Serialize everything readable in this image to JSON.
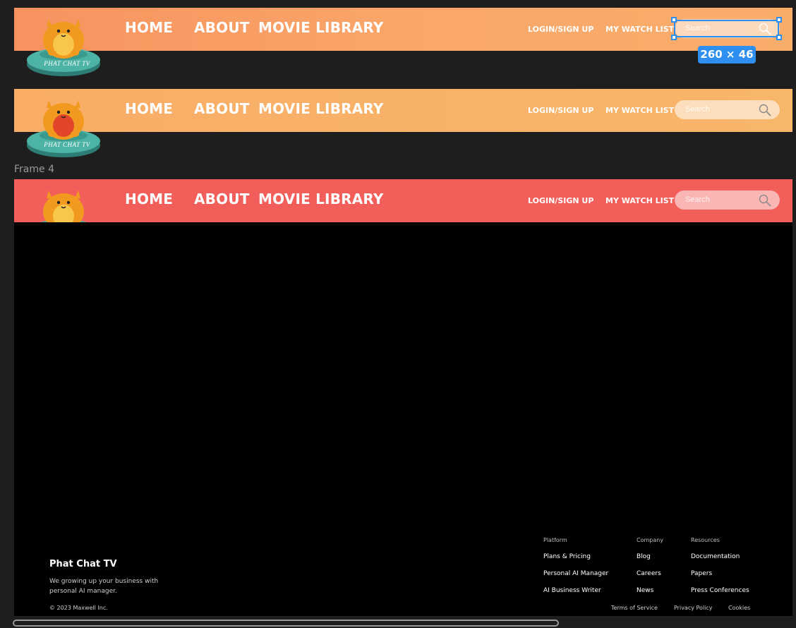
{
  "colors": {
    "canvas_bg": "#1e1e1e",
    "header_1_gradient": [
      "#f8925f",
      "#f9a86a",
      "#f9ad6b"
    ],
    "header_2_gradient": [
      "#f9ad66",
      "#f8b66b"
    ],
    "header_3_bg": "#f25e59",
    "selection_accent": "#2f8ff0",
    "frame_body_bg": "#000000"
  },
  "logo": {
    "text": "PHAT CHAT TV",
    "icon": "orange-cat-on-teal-cushion"
  },
  "nav": {
    "home": "HOME",
    "about": "ABOUT",
    "movie_library": "MOVIE LIBRARY",
    "login": "LOGIN/SIGN UP",
    "watch_list": "MY WATCH LIST",
    "search_placeholder": "Search",
    "search_icon": "magnifier"
  },
  "selection": {
    "dimensions": "260 × 46"
  },
  "frame_label": "Frame 4",
  "footer": {
    "brand": "Phat Chat TV",
    "tagline": "We growing up your business with personal AI manager.",
    "copyright": "© 2023 Maxwell Inc.",
    "columns": [
      {
        "heading": "Platform",
        "links": [
          "Plans & Pricing",
          "Personal AI Manager",
          "AI Business Writer"
        ]
      },
      {
        "heading": "Company",
        "links": [
          "Blog",
          "Careers",
          "News"
        ]
      },
      {
        "heading": "Resources",
        "links": [
          "Documentation",
          "Papers",
          "Press Conferences"
        ]
      }
    ],
    "legal": {
      "terms": "Terms of Service",
      "privacy": "Privacy Policy",
      "cookies": "Cookies"
    }
  }
}
